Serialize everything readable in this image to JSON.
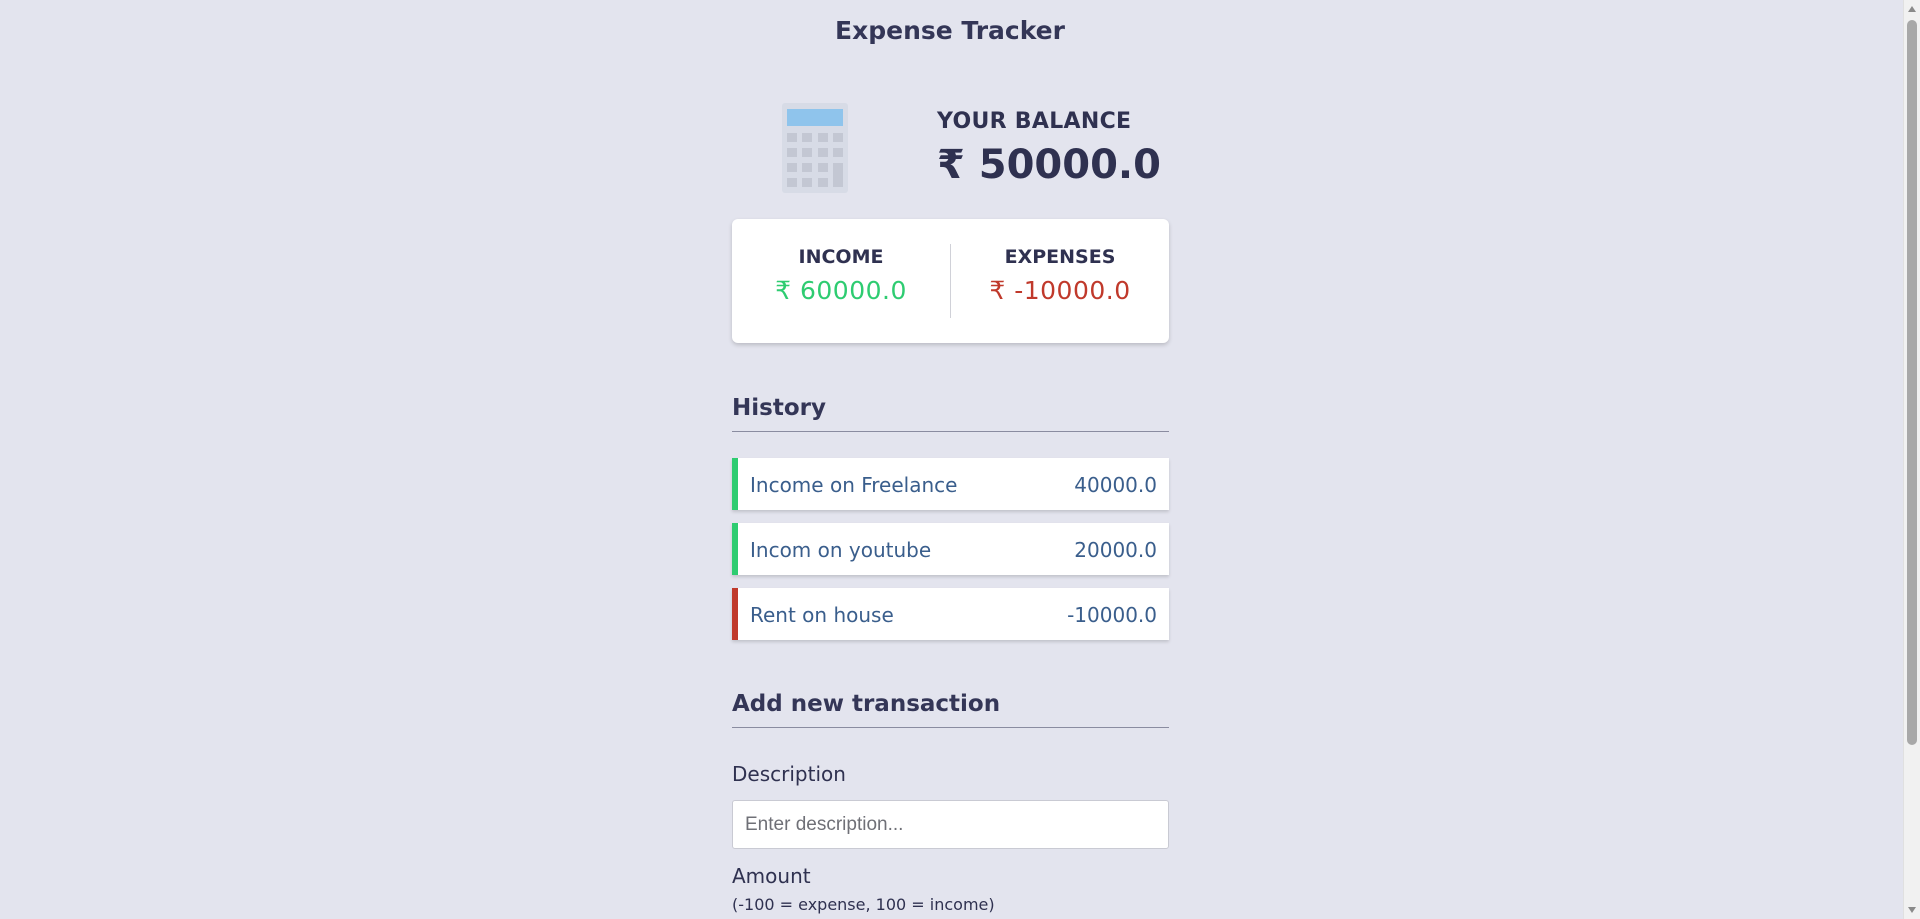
{
  "header": {
    "title": "Expense Tracker"
  },
  "balance": {
    "label": "YOUR BALANCE",
    "value": "₹ 50000.0",
    "icon": "calculator-icon"
  },
  "summary": {
    "income_label": "INCOME",
    "income_value": "₹ 60000.0",
    "expense_label": "EXPENSES",
    "expense_value": "₹ -10000.0"
  },
  "history": {
    "title": "History",
    "items": [
      {
        "text": "Income on Freelance",
        "amount": "40000.0",
        "type": "plus"
      },
      {
        "text": "Incom on youtube",
        "amount": "20000.0",
        "type": "plus"
      },
      {
        "text": "Rent on house",
        "amount": "-10000.0",
        "type": "minus"
      }
    ]
  },
  "form": {
    "title": "Add new transaction",
    "description_label": "Description",
    "description_placeholder": "Enter description...",
    "description_value": "",
    "amount_label": "Amount",
    "amount_hint": "(-100 = expense, 100 = income)"
  },
  "colors": {
    "background": "#e3e4ee",
    "income": "#2ecc71",
    "expense": "#c0392b",
    "text": "#2f3150"
  }
}
